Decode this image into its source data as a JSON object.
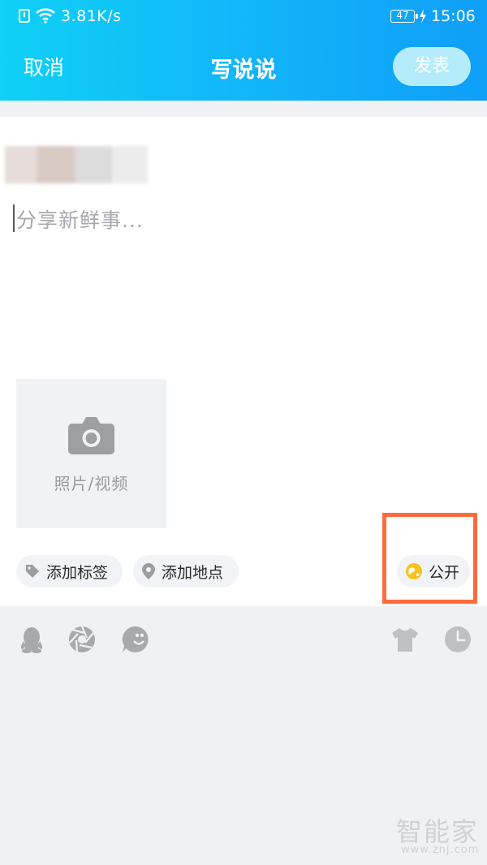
{
  "status_bar": {
    "net_speed": "3.81K/s",
    "battery": "47",
    "time": "15:06"
  },
  "nav": {
    "cancel": "取消",
    "title": "写说说",
    "publish": "发表"
  },
  "compose": {
    "placeholder": "分享新鲜事..."
  },
  "media": {
    "label": "照片/视频"
  },
  "chips": {
    "tag": "添加标签",
    "location": "添加地点",
    "visibility": "公开"
  },
  "toolbar": {
    "icons": [
      "qq-icon",
      "aperture-icon",
      "emoji-icon",
      "shirt-icon",
      "clock-icon"
    ]
  },
  "watermark": {
    "brand": "智能家",
    "url": "www.znj.com"
  },
  "colors": {
    "header_start": "#0fd0f6",
    "header_end": "#0f9ef8",
    "highlight": "#ff6b3b",
    "publisher_button": "#b4ecfc"
  }
}
